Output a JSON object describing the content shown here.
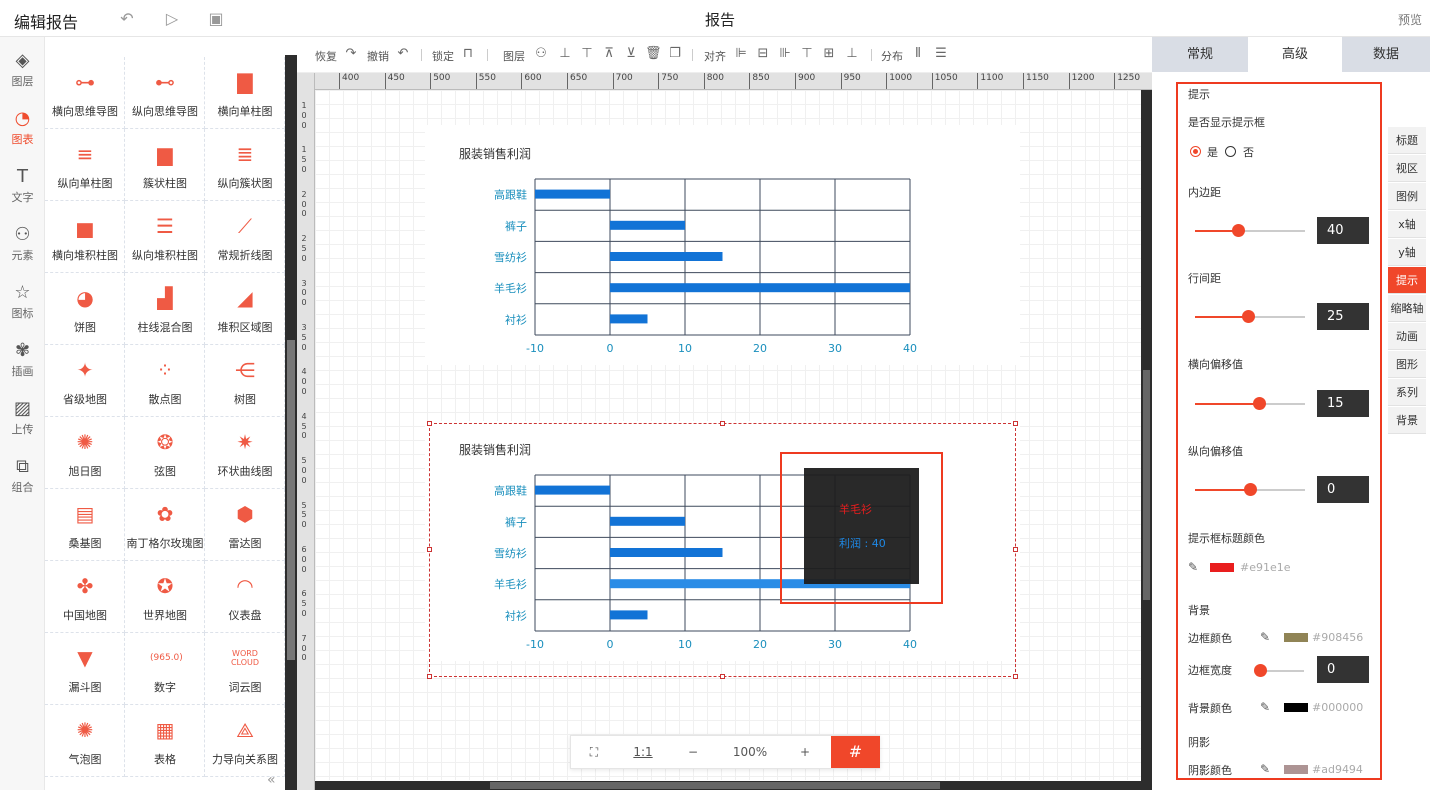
{
  "topbar": {
    "title": "编辑报告",
    "center": "报告",
    "preview": "预览"
  },
  "rail": [
    {
      "label": "图层",
      "icon": "layers-icon"
    },
    {
      "label": "图表",
      "icon": "chart-icon",
      "active": true
    },
    {
      "label": "文字",
      "icon": "text-icon"
    },
    {
      "label": "元素",
      "icon": "shapes-icon"
    },
    {
      "label": "图标",
      "icon": "star-icon"
    },
    {
      "label": "插画",
      "icon": "palette-icon"
    },
    {
      "label": "上传",
      "icon": "upload-image-icon"
    },
    {
      "label": "组合",
      "icon": "group-icon"
    }
  ],
  "palette": [
    "横向思维导图",
    "纵向思维导图",
    "横向单柱图",
    "纵向单柱图",
    "簇状柱图",
    "纵向簇状图",
    "横向堆积柱图",
    "纵向堆积柱图",
    "常规折线图",
    "饼图",
    "柱线混合图",
    "堆积区域图",
    "省级地图",
    "散点图",
    "树图",
    "旭日图",
    "弦图",
    "环状曲线图",
    "桑基图",
    "南丁格尔玫瑰图",
    "雷达图",
    "中国地图",
    "世界地图",
    "仪表盘",
    "漏斗图",
    "数字",
    "词云图",
    "气泡图",
    "表格",
    "力导向关系图"
  ],
  "palette_number_sample": "(965.0)",
  "palette_wordcloud_sample": [
    "WORD",
    "CLOUD"
  ],
  "toolbar": {
    "redo": "恢复",
    "undo": "撤销",
    "lock": "锁定",
    "layer": "图层",
    "align": "对齐",
    "distribute": "分布"
  },
  "ruler_ticks": [
    "400",
    "450",
    "500",
    "550",
    "600",
    "650",
    "700",
    "750",
    "800",
    "850",
    "900",
    "950",
    "1000",
    "1050",
    "1100",
    "1150",
    "1200",
    "1250"
  ],
  "vruler_ticks": [
    "1",
    "0",
    "0",
    "1",
    "5",
    "0",
    "2",
    "0",
    "0",
    "2",
    "5",
    "0",
    "3",
    "0",
    "0",
    "3",
    "5",
    "0",
    "4",
    "0",
    "0",
    "4",
    "5",
    "0",
    "5",
    "0",
    "0",
    "5",
    "5",
    "0",
    "6",
    "0",
    "0",
    "6",
    "5",
    "0",
    "7",
    "0",
    "0"
  ],
  "zoom": {
    "fit": "⛶",
    "one_to_one": "1:1",
    "minus": "−",
    "level": "100%",
    "plus": "+",
    "grid": "#"
  },
  "chart_data": [
    {
      "type": "bar",
      "orientation": "horizontal",
      "title": "服装销售利润",
      "categories": [
        "高跟鞋",
        "裤子",
        "雪纺衫",
        "羊毛衫",
        "衬衫"
      ],
      "values": [
        -10,
        10,
        15,
        40,
        5
      ],
      "xlim": [
        -10,
        40
      ],
      "xticks": [
        "-10",
        "0",
        "10",
        "20",
        "30",
        "40"
      ],
      "bar_color": "#1273d6",
      "grid": true
    },
    {
      "type": "bar",
      "orientation": "horizontal",
      "title": "服装销售利润",
      "categories": [
        "高跟鞋",
        "裤子",
        "雪纺衫",
        "羊毛衫",
        "衬衫"
      ],
      "values": [
        -10,
        10,
        15,
        40,
        5
      ],
      "xlim": [
        -10,
        40
      ],
      "xticks": [
        "-10",
        "0",
        "10",
        "20",
        "30",
        "40"
      ],
      "bar_color": "#1273d6",
      "highlight_color": "#2a8ce6",
      "highlighted": "羊毛衫",
      "grid": true
    }
  ],
  "tooltip": {
    "title": "羊毛衫",
    "value": "利润 : 40",
    "title_color": "#e91e1e",
    "value_color": "#1e88e5"
  },
  "rpanel": {
    "tabs": [
      {
        "label": "常规"
      },
      {
        "label": "高级",
        "active": true
      },
      {
        "label": "数据"
      }
    ],
    "side_tabs": [
      "标题",
      "视区",
      "图例",
      "x轴",
      "y轴",
      "提示",
      "缩略轴",
      "动画",
      "图形",
      "系列",
      "背景"
    ],
    "side_active": "提示",
    "section": "提示",
    "show_tooltip_label": "是否显示提示框",
    "yes": "是",
    "no": "否",
    "show_tooltip": true,
    "padding": {
      "label": "内边距",
      "value": "40",
      "fraction": 0.39
    },
    "line_height": {
      "label": "行间距",
      "value": "25",
      "fraction": 0.48
    },
    "offset_x": {
      "label": "横向偏移值",
      "value": "15",
      "fraction": 0.58
    },
    "offset_y": {
      "label": "纵向偏移值",
      "value": "0",
      "fraction": 0.5
    },
    "title_color": {
      "label": "提示框标题颜色",
      "value": "#e91e1e"
    },
    "bg_section": "背景",
    "border_color": {
      "label": "边框颜色",
      "value": "#908456"
    },
    "border_width": {
      "label": "边框宽度",
      "value": "0",
      "fraction": 0
    },
    "bg_color": {
      "label": "背景颜色",
      "value": "#000000"
    },
    "shadow_section": "阴影",
    "shadow_color": {
      "label": "阴影颜色",
      "value": "#ad9494"
    }
  }
}
